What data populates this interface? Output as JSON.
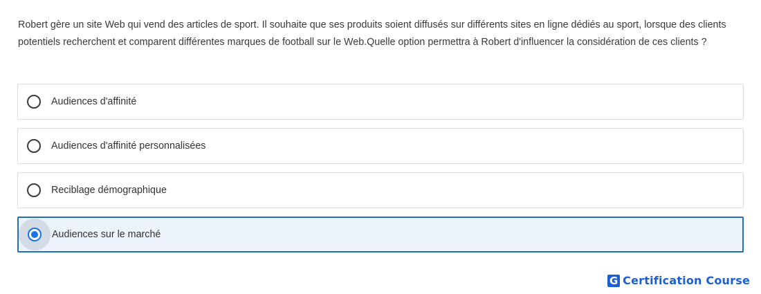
{
  "question": {
    "text": "Robert gère un site Web qui vend des articles de sport. Il souhaite que ses produits soient diffusés sur différents sites en ligne dédiés au sport, lorsque des clients potentiels recherchent et comparent différentes marques de football sur le Web.Quelle option permettra à Robert d'influencer la considération de ces clients ?"
  },
  "options": [
    {
      "label": "Audiences d'affinité",
      "selected": false
    },
    {
      "label": "Audiences d'affinité personnalisées",
      "selected": false
    },
    {
      "label": "Reciblage démographique",
      "selected": false
    },
    {
      "label": "Audiences sur le marché",
      "selected": true
    }
  ],
  "brand": {
    "logo_letter": "G",
    "name": "Certification Course",
    "color": "#1a5fd6"
  },
  "colors": {
    "accent": "#1a73e8",
    "selected_border": "#1f6fc9",
    "selected_background": "#ecf3fd"
  }
}
